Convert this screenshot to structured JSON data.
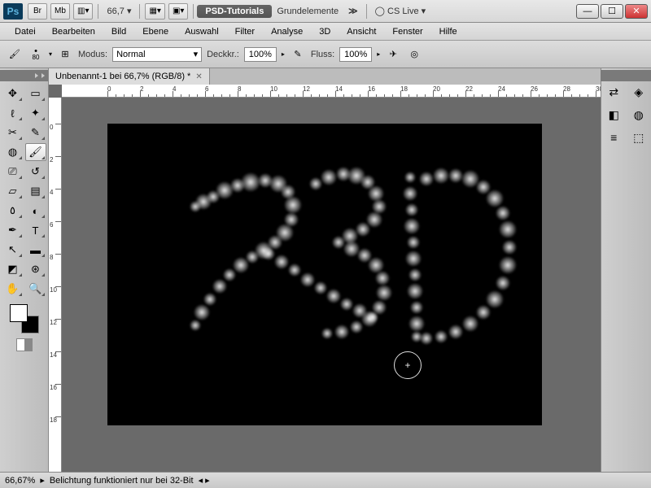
{
  "app": {
    "logo": "Ps"
  },
  "topbar": {
    "br": "Br",
    "mb": "Mb",
    "zoom": "66,7",
    "label1": "PSD-Tutorials",
    "label2": "Grundelemente",
    "cslive": "CS Live"
  },
  "menu": [
    "Datei",
    "Bearbeiten",
    "Bild",
    "Ebene",
    "Auswahl",
    "Filter",
    "Analyse",
    "3D",
    "Ansicht",
    "Fenster",
    "Hilfe"
  ],
  "opts": {
    "brush_size": "80",
    "mode_label": "Modus:",
    "mode_value": "Normal",
    "opacity_label": "Deckkr.:",
    "opacity_value": "100%",
    "flow_label": "Fluss:",
    "flow_value": "100%"
  },
  "doc": {
    "title": "Unbenannt-1 bei 66,7% (RGB/8) *"
  },
  "ruler_x": [
    0,
    2,
    4,
    6,
    8,
    10,
    12,
    14,
    16,
    18,
    20,
    22,
    24,
    26,
    28,
    30
  ],
  "ruler_y": [
    0,
    2,
    4,
    6,
    8,
    10,
    12,
    14,
    16,
    18
  ],
  "status": {
    "zoom": "66,67%",
    "msg": "Belichtung funktioniert nur bei 32-Bit"
  },
  "tools": [
    {
      "n": "move",
      "g": "✥"
    },
    {
      "n": "marquee",
      "g": "▭"
    },
    {
      "n": "lasso",
      "g": "ℓ"
    },
    {
      "n": "wand",
      "g": "✦"
    },
    {
      "n": "crop",
      "g": "✂"
    },
    {
      "n": "eyedropper",
      "g": "✎"
    },
    {
      "n": "heal",
      "g": "◍"
    },
    {
      "n": "brush",
      "g": "🖌",
      "sel": true
    },
    {
      "n": "stamp",
      "g": "⎚"
    },
    {
      "n": "history",
      "g": "↺"
    },
    {
      "n": "eraser",
      "g": "▱"
    },
    {
      "n": "gradient",
      "g": "▤"
    },
    {
      "n": "blur",
      "g": "٥"
    },
    {
      "n": "dodge",
      "g": "◐"
    },
    {
      "n": "pen",
      "g": "✒"
    },
    {
      "n": "type",
      "g": "T"
    },
    {
      "n": "path",
      "g": "↖"
    },
    {
      "n": "shape",
      "g": "▬"
    },
    {
      "n": "3d",
      "g": "◩"
    },
    {
      "n": "3dcam",
      "g": "⊛"
    },
    {
      "n": "hand",
      "g": "✋"
    },
    {
      "n": "zoom",
      "g": "🔍"
    }
  ],
  "strokes": [
    [
      108,
      102,
      14
    ],
    [
      118,
      96,
      20
    ],
    [
      130,
      90,
      16
    ],
    [
      144,
      82,
      22
    ],
    [
      160,
      76,
      18
    ],
    [
      176,
      72,
      24
    ],
    [
      194,
      70,
      18
    ],
    [
      210,
      74,
      22
    ],
    [
      222,
      84,
      18
    ],
    [
      228,
      100,
      22
    ],
    [
      226,
      118,
      18
    ],
    [
      218,
      134,
      22
    ],
    [
      206,
      146,
      18
    ],
    [
      192,
      156,
      22
    ],
    [
      178,
      164,
      16
    ],
    [
      164,
      174,
      20
    ],
    [
      150,
      186,
      16
    ],
    [
      138,
      200,
      18
    ],
    [
      126,
      216,
      16
    ],
    [
      116,
      232,
      20
    ],
    [
      108,
      248,
      14
    ],
    [
      198,
      160,
      16
    ],
    [
      214,
      170,
      18
    ],
    [
      230,
      180,
      16
    ],
    [
      246,
      192,
      18
    ],
    [
      262,
      202,
      16
    ],
    [
      278,
      212,
      18
    ],
    [
      294,
      222,
      16
    ],
    [
      310,
      230,
      18
    ],
    [
      326,
      238,
      14
    ],
    [
      256,
      74,
      16
    ],
    [
      272,
      66,
      20
    ],
    [
      290,
      62,
      18
    ],
    [
      306,
      64,
      22
    ],
    [
      320,
      72,
      18
    ],
    [
      330,
      86,
      20
    ],
    [
      334,
      102,
      18
    ],
    [
      328,
      118,
      20
    ],
    [
      314,
      130,
      18
    ],
    [
      298,
      138,
      20
    ],
    [
      284,
      146,
      16
    ],
    [
      300,
      154,
      20
    ],
    [
      316,
      162,
      18
    ],
    [
      330,
      174,
      20
    ],
    [
      338,
      190,
      18
    ],
    [
      340,
      208,
      20
    ],
    [
      334,
      226,
      18
    ],
    [
      322,
      240,
      20
    ],
    [
      306,
      250,
      16
    ],
    [
      288,
      256,
      18
    ],
    [
      270,
      258,
      14
    ],
    [
      372,
      66,
      14
    ],
    [
      372,
      86,
      18
    ],
    [
      374,
      106,
      16
    ],
    [
      374,
      126,
      20
    ],
    [
      376,
      146,
      16
    ],
    [
      376,
      166,
      20
    ],
    [
      378,
      186,
      16
    ],
    [
      378,
      206,
      20
    ],
    [
      380,
      226,
      16
    ],
    [
      380,
      246,
      20
    ],
    [
      380,
      262,
      14
    ],
    [
      392,
      68,
      18
    ],
    [
      410,
      64,
      20
    ],
    [
      428,
      64,
      18
    ],
    [
      446,
      68,
      22
    ],
    [
      462,
      78,
      18
    ],
    [
      476,
      92,
      22
    ],
    [
      486,
      110,
      18
    ],
    [
      492,
      130,
      22
    ],
    [
      494,
      152,
      18
    ],
    [
      492,
      174,
      22
    ],
    [
      486,
      196,
      18
    ],
    [
      476,
      216,
      22
    ],
    [
      462,
      232,
      18
    ],
    [
      446,
      246,
      20
    ],
    [
      428,
      256,
      18
    ],
    [
      410,
      262,
      16
    ],
    [
      392,
      264,
      16
    ]
  ]
}
